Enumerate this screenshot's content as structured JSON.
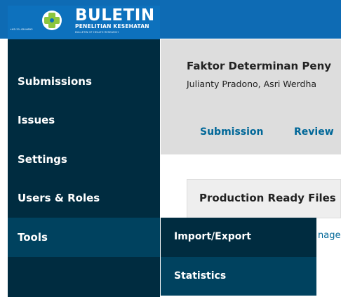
{
  "header": {
    "logo_title": "BULETIN",
    "logo_subtitle": "PENELITIAN KESEHATAN",
    "logo_subsubtitle": "BULLETIN OF HEALTH RESEARCH",
    "logo_contact": "+62-21-4244693",
    "colors": {
      "bar": "#0e6bb4",
      "logo_bg": "#0d71bd"
    }
  },
  "sidebar": {
    "items": [
      {
        "label": "Submissions"
      },
      {
        "label": "Issues"
      },
      {
        "label": "Settings"
      },
      {
        "label": "Users & Roles"
      },
      {
        "label": "Tools"
      }
    ],
    "active": "Tools"
  },
  "flyout": {
    "items": [
      {
        "label": "Import/Export"
      },
      {
        "label": "Statistics"
      }
    ]
  },
  "main": {
    "article_title": "Faktor Determinan Peny",
    "article_authors": "Julianty Pradono, Asri Werdha",
    "tabs": [
      {
        "label": "Submission"
      },
      {
        "label": "Review"
      }
    ],
    "panel_title": "Production Ready Files",
    "panel_link": "nage"
  }
}
